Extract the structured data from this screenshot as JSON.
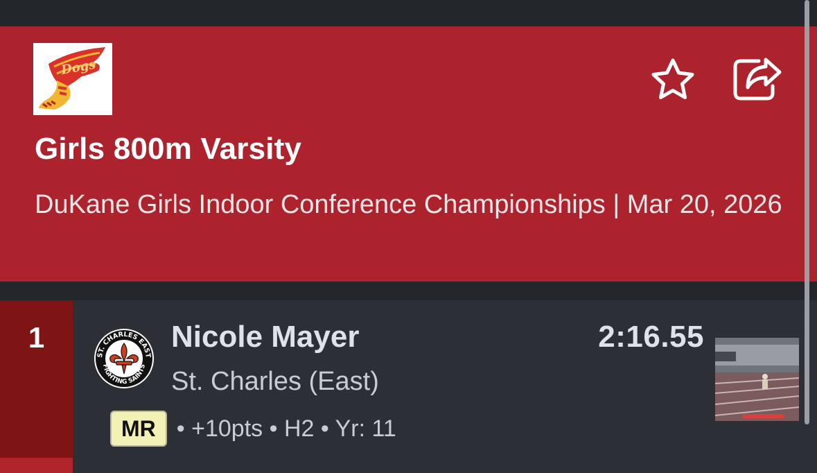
{
  "header": {
    "event_title": "Girls 800m Varsity",
    "meet_info": "DuKane Girls Indoor Conference Championships | Mar 20, 2026",
    "logo_text": "Dogs",
    "favorite_icon": "star-outline-icon",
    "share_icon": "share-icon",
    "background_color": "#ac232e"
  },
  "result": {
    "place": "1",
    "athlete": "Nicole Mayer",
    "team": "St. Charles (East)",
    "mark": "2:16.55",
    "badge": "MR",
    "details": "• +10pts • H2 • Yr: 11",
    "school_logo": {
      "top_text": "ST. CHARLES EAST",
      "bottom_text": "FIGHTING SAINTS",
      "symbol": "fleur-de-lis-icon"
    },
    "place_color": "#7e1514",
    "badge_color": "#f3f1b5"
  }
}
